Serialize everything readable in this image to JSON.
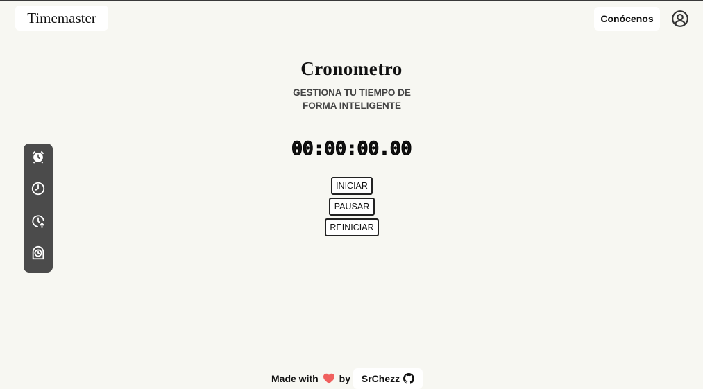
{
  "header": {
    "brand": "Timemaster",
    "about_label": "Conócenos",
    "user_icon": "user-circle-icon"
  },
  "main": {
    "title": "Cronometro",
    "subtitle": "GESTIONA TU TIEMPO DE FORMA INTELIGENTE",
    "timer": "00:00:00.00",
    "buttons": {
      "start": "INICIAR",
      "pause": "PAUSAR",
      "reset": "REINICIAR"
    }
  },
  "sidebar": {
    "items": [
      {
        "icon": "alarm-clock-icon"
      },
      {
        "icon": "clock-icon"
      },
      {
        "icon": "clock-upload-icon"
      },
      {
        "icon": "desk-clock-icon"
      }
    ]
  },
  "footer": {
    "made_with": "Made with",
    "by": "by",
    "author": "SrChezz",
    "heart_icon": "heart-icon",
    "github_icon": "github-icon",
    "heart_color": "#f0605e"
  },
  "colors": {
    "background": "#f7f7f2",
    "sidebar": "#4b4b4b"
  }
}
